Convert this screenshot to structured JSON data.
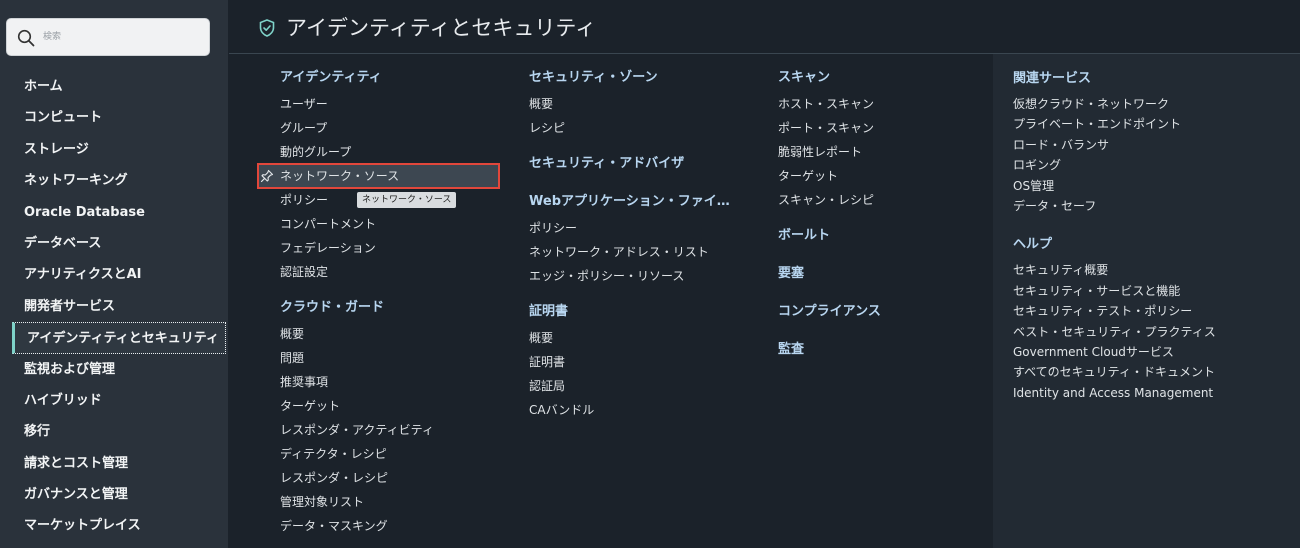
{
  "search": {
    "placeholder": "検索"
  },
  "sidebar": {
    "items": [
      {
        "label": "ホーム"
      },
      {
        "label": "コンピュート"
      },
      {
        "label": "ストレージ"
      },
      {
        "label": "ネットワーキング"
      },
      {
        "label": "Oracle Database"
      },
      {
        "label": "データベース"
      },
      {
        "label": "アナリティクスとAI"
      },
      {
        "label": "開発者サービス"
      },
      {
        "label": "アイデンティティとセキュリティ",
        "active": true
      },
      {
        "label": "監視および管理"
      },
      {
        "label": "ハイブリッド"
      },
      {
        "label": "移行"
      },
      {
        "label": "請求とコスト管理"
      },
      {
        "label": "ガバナンスと管理"
      },
      {
        "label": "マーケットプレイス"
      }
    ]
  },
  "header": {
    "title": "アイデンティティとセキュリティ",
    "icon": "shield-check-icon",
    "accent_color": "#7fd3c9"
  },
  "col1": {
    "identity": {
      "heading": "アイデンティティ",
      "links": [
        "ユーザー",
        "グループ",
        "動的グループ",
        "ネットワーク・ソース",
        "ポリシー",
        "コンパートメント",
        "フェデレーション",
        "認証設定"
      ]
    },
    "cloud_guard": {
      "heading": "クラウド・ガード",
      "links": [
        "概要",
        "問題",
        "推奨事項",
        "ターゲット",
        "レスポンダ・アクティビティ",
        "ディテクタ・レシピ",
        "レスポンダ・レシピ",
        "管理対象リスト",
        "データ・マスキング"
      ]
    }
  },
  "col2": {
    "security_zone": {
      "heading": "セキュリティ・ゾーン",
      "links": [
        "概要",
        "レシピ"
      ]
    },
    "security_advisor": {
      "heading": "セキュリティ・アドバイザ"
    },
    "waf": {
      "heading": "Webアプリケーション・ファイ…",
      "links": [
        "ポリシー",
        "ネットワーク・アドレス・リスト",
        "エッジ・ポリシー・リソース"
      ]
    },
    "certificates": {
      "heading": "証明書",
      "links": [
        "概要",
        "証明書",
        "認証局",
        "CAバンドル"
      ]
    }
  },
  "col3": {
    "scan": {
      "heading": "スキャン",
      "links": [
        "ホスト・スキャン",
        "ポート・スキャン",
        "脆弱性レポート",
        "ターゲット",
        "スキャン・レシピ"
      ]
    },
    "vault": {
      "heading": "ボールト"
    },
    "bastion": {
      "heading": "要塞"
    },
    "compliance": {
      "heading": "コンプライアンス"
    },
    "audit": {
      "heading": "監査"
    }
  },
  "col4": {
    "related": {
      "heading": "関連サービス",
      "links": [
        "仮想クラウド・ネットワーク",
        "プライベート・エンドポイント",
        "ロード・バランサ",
        "ロギング",
        "OS管理",
        "データ・セーフ"
      ]
    },
    "help": {
      "heading": "ヘルプ",
      "links": [
        "セキュリティ概要",
        "セキュリティ・サービスと機能",
        "セキュリティ・テスト・ポリシー",
        "ベスト・セキュリティ・プラクティス",
        "Government Cloudサービス",
        "すべてのセキュリティ・ドキュメント",
        "Identity and Access Management"
      ]
    }
  },
  "tooltip": {
    "text": "ネットワーク・ソース"
  },
  "colors": {
    "highlight_border": "#e2473b",
    "section_heading": "#b8d6f0"
  }
}
